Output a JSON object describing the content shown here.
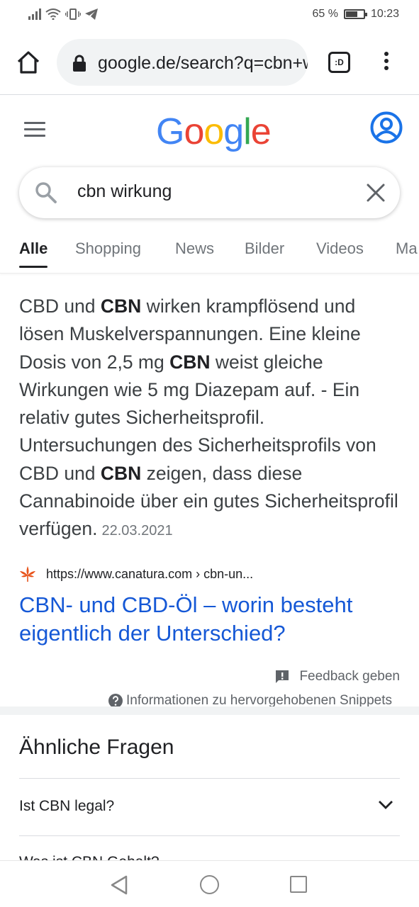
{
  "status": {
    "battery_percent": "65 %",
    "battery_level": 0.65,
    "time": "10:23"
  },
  "browser": {
    "url": "google.de/search?q=cbn+wirkung",
    "tab_count": ":D"
  },
  "google": {
    "logo_letters": [
      {
        "ch": "G",
        "color": "#4285F4"
      },
      {
        "ch": "o",
        "color": "#EA4335"
      },
      {
        "ch": "o",
        "color": "#FBBC05"
      },
      {
        "ch": "g",
        "color": "#4285F4"
      },
      {
        "ch": "l",
        "color": "#34A853"
      },
      {
        "ch": "e",
        "color": "#EA4335"
      }
    ]
  },
  "search": {
    "query": "cbn wirkung"
  },
  "tabs": [
    {
      "label": "Alle",
      "active": true
    },
    {
      "label": "Shopping"
    },
    {
      "label": "News"
    },
    {
      "label": "Bilder"
    },
    {
      "label": "Videos"
    },
    {
      "label": "Ma"
    }
  ],
  "snippet": {
    "segments": [
      {
        "t": "CBD und "
      },
      {
        "t": "CBN",
        "b": true
      },
      {
        "t": " wirken krampflösend und lösen Muskelverspannungen. Eine kleine Dosis von 2,5 mg "
      },
      {
        "t": "CBN",
        "b": true
      },
      {
        "t": " weist gleiche Wirkungen wie 5 mg Diazepam auf. - Ein relativ gutes Sicherheitsprofil. Untersuchungen des Sicherheitsprofils von CBD und "
      },
      {
        "t": "CBN",
        "b": true
      },
      {
        "t": " zeigen, dass diese Cannabinoide über ein gutes Sicherheitsprofil verfügen."
      }
    ],
    "date": "22.03.2021",
    "source_url": "https://www.canatura.com › cbn-un...",
    "title": "CBN- und CBD-Öl – worin besteht eigentlich der Unterschied?"
  },
  "feedback_label": "Feedback geben",
  "info_label": "Informationen zu hervorgehobenen Snippets",
  "paa": {
    "title": "Ähnliche Fragen",
    "questions": [
      "Ist CBN legal?",
      "Was ist CBN Gehalt?"
    ]
  },
  "colors": {
    "link": "#1558d6",
    "accent_blue": "#1a73e8"
  }
}
